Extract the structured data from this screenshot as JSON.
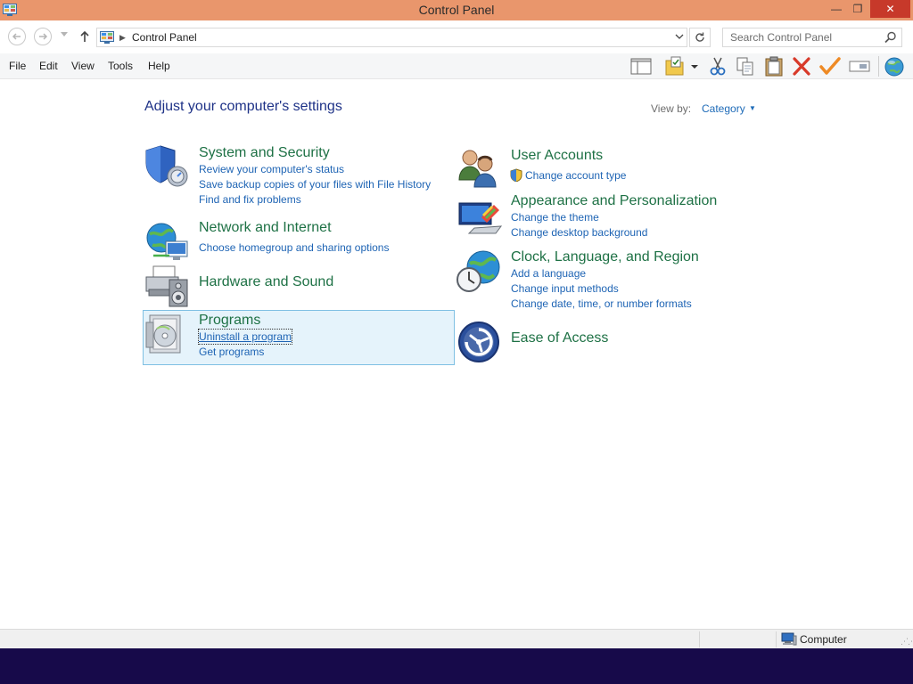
{
  "window": {
    "title": "Control Panel",
    "minimize_glyph": "—",
    "restore_glyph": "❐",
    "close_glyph": "✕"
  },
  "address_bar": {
    "breadcrumb": "Control Panel",
    "search_placeholder": "Search Control Panel"
  },
  "menu": {
    "items": [
      {
        "label": "File"
      },
      {
        "label": "Edit"
      },
      {
        "label": "View"
      },
      {
        "label": "Tools"
      },
      {
        "label": "Help"
      }
    ]
  },
  "toolbar": {
    "icons": [
      "preview-pane-icon",
      "properties-icon",
      "cut-icon",
      "copy-icon",
      "paste-icon",
      "delete-icon",
      "undo-icon",
      "rename-icon",
      "internet-icon"
    ]
  },
  "content": {
    "heading": "Adjust your computer's settings",
    "view_by_label": "View by:",
    "view_by_value": "Category",
    "categories": [
      {
        "title": "System and Security",
        "icon": "shield-icon",
        "links": [
          "Review your computer's status",
          "Save backup copies of your files with File History",
          "Find and fix problems"
        ]
      },
      {
        "title": "Network and Internet",
        "icon": "network-globe-icon",
        "links": [
          "Choose homegroup and sharing options"
        ]
      },
      {
        "title": "Hardware and Sound",
        "icon": "printer-speaker-icon",
        "links": []
      },
      {
        "title": "Programs",
        "icon": "programs-disc-icon",
        "links": [
          "Uninstall a program",
          "Get programs"
        ]
      },
      {
        "title": "User Accounts",
        "icon": "users-icon",
        "links": [
          "Change account type"
        ]
      },
      {
        "title": "Appearance and Personalization",
        "icon": "monitor-palette-icon",
        "links": [
          "Change the theme",
          "Change desktop background"
        ]
      },
      {
        "title": "Clock, Language, and Region",
        "icon": "clock-globe-icon",
        "links": [
          "Add a language",
          "Change input methods",
          "Change date, time, or number formats"
        ]
      },
      {
        "title": "Ease of Access",
        "icon": "ease-of-access-icon",
        "links": []
      }
    ]
  },
  "status_bar": {
    "location": "Computer"
  },
  "colors": {
    "title_bar": "#e9966c",
    "close_button": "#c7392a",
    "category_title": "#1e7145",
    "link": "#1e64b4",
    "heading": "#1e3287",
    "selection_fill": "#e5f3fb",
    "selection_border": "#7fc0e3",
    "taskbar": "#170a4a"
  }
}
